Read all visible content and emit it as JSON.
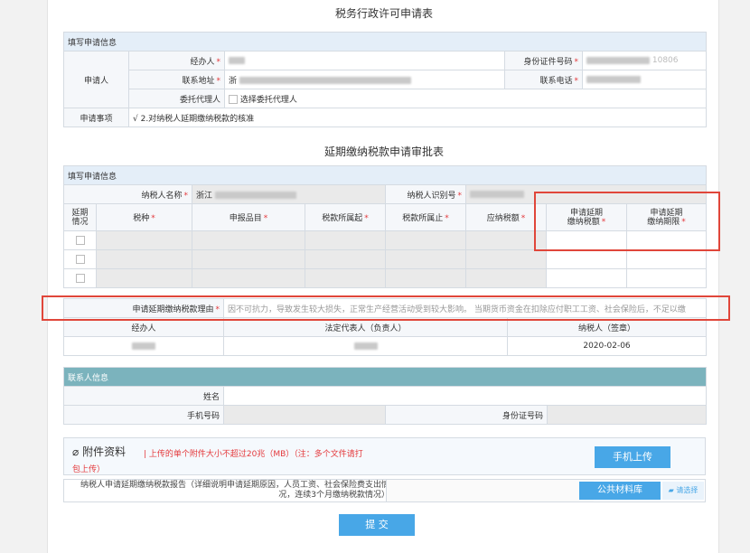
{
  "form_title": "税务行政许可申请表",
  "applicant": {
    "section": "填写申请信息",
    "row_label": "申请人",
    "agent_label": "经办人",
    "id_label": "身份证件号码",
    "id_suffix": "10806",
    "address_label": "联系地址",
    "address_prefix": "浙",
    "phone_label": "联系电话",
    "delegate_label": "委托代理人",
    "delegate_option": "选择委托代理人",
    "matter_label": "申请事项",
    "matter_value": "√ 2.对纳税人延期缴纳税款的核准"
  },
  "approval_title": "延期缴纳税款申请审批表",
  "approval": {
    "section": "填写申请信息",
    "taxpayer_name_label": "纳税人名称",
    "taxpayer_name_prefix": "浙江",
    "taxpayer_id_label": "纳税人识别号",
    "col_status": "延期\n情况",
    "col_tax_type": "税种",
    "col_item": "申报品目",
    "col_start": "税款所属起",
    "col_end": "税款所属止",
    "col_payable": "应纳税额",
    "col_delay_amount": "申请延期\n缴纳税额",
    "col_delay_deadline": "申请延期\n缴纳期限",
    "reason_label": "申请延期缴纳税款理由",
    "reason_text": "因不可抗力，导致发生较大损失，正常生产经营活动受到较大影响。 当期货币资金在扣除应付职工工资、社会保险后，不足以缴",
    "sign_agent": "经办人",
    "sign_legal": "法定代表人（负责人）",
    "sign_taxpayer": "纳税人（签章）",
    "sign_date": "2020-02-06"
  },
  "contact": {
    "section": "联系人信息",
    "name_label": "姓名",
    "mobile_label": "手机号码",
    "id_label": "身份证号码"
  },
  "attachments": {
    "title": "附件资料",
    "note": "| 上传的单个附件大小不超过20兆（MB）（注：多个文件请打",
    "note2": "包上传）",
    "mobile_upload": "手机上传",
    "doc_name": "纳税人申请延期缴纳税款报告（详细说明申请延期原因，人员工资、社会保险费支出情",
    "doc_name2": "况，连续3个月缴纳税款情况）",
    "public_lib": "公共材料库",
    "choose": "请选择"
  },
  "submit": "提 交",
  "colors": {
    "header_bg": "#e4eef8",
    "teal": "#7bb3bd",
    "button": "#48a7e7",
    "highlight": "#e0463a",
    "required": "#e4393c"
  }
}
